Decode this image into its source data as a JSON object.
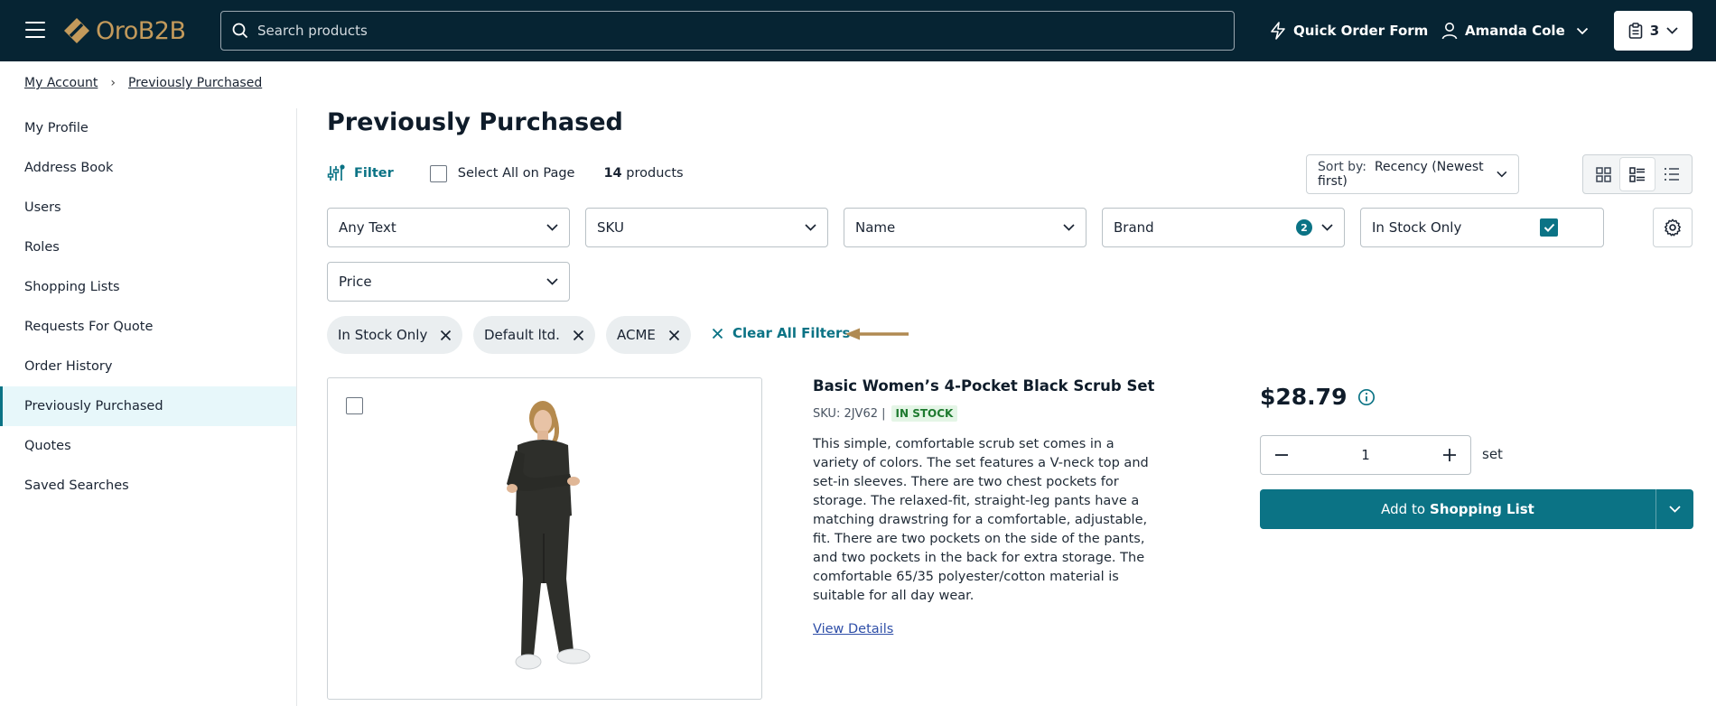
{
  "header": {
    "logo_text": "OroB2B",
    "search_placeholder": "Search products",
    "quick_order_label": "Quick Order Form",
    "user_name": "Amanda Cole",
    "cart_count": "3"
  },
  "breadcrumb": [
    "My Account",
    "Previously Purchased"
  ],
  "sidebar": {
    "items": [
      {
        "label": "My Profile"
      },
      {
        "label": "Address Book"
      },
      {
        "label": "Users"
      },
      {
        "label": "Roles"
      },
      {
        "label": "Shopping Lists"
      },
      {
        "label": "Requests For Quote"
      },
      {
        "label": "Order History"
      },
      {
        "label": "Previously Purchased",
        "active": true
      },
      {
        "label": "Quotes"
      },
      {
        "label": "Saved Searches"
      }
    ]
  },
  "main": {
    "title": "Previously Purchased",
    "filter_label": "Filter",
    "select_all_label": "Select All on Page",
    "count_number": "14",
    "count_suffix": "products",
    "sort_label": "Sort by:",
    "sort_value": "Recency (Newest first)",
    "filters": {
      "any_text": "Any Text",
      "sku": "SKU",
      "name": "Name",
      "brand": "Brand",
      "brand_count": "2",
      "in_stock": "In Stock Only",
      "price": "Price"
    },
    "chips": [
      "In Stock Only",
      "Default ltd.",
      "ACME"
    ],
    "clear_all_label": "Clear All Filters"
  },
  "product": {
    "name": "Basic Women’s 4-Pocket Black Scrub Set",
    "sku": "SKU: 2JV62 |",
    "stock": "IN STOCK",
    "description": "This simple, comfortable scrub set comes in a variety of colors. The set features a V-neck top and set-in sleeves. There are two chest pockets for storage. The relaxed-fit, straight-leg pants have a matching drawstring for a comfortable, adjustable, fit. There are two pockets on the side of the pants, and two pockets in the back for extra storage. The comfortable 65/35 polyester/cotton material is suitable for all day wear.",
    "view_details": "View Details",
    "price": "$28.79",
    "quantity": "1",
    "unit": "set",
    "add_label_prefix": "Add to",
    "add_label_strong": "Shopping List"
  },
  "colors": {
    "header_bg": "#062433",
    "accent": "#0b7385",
    "logo": "#c39a5b",
    "annotation_arrow": "#b08a52"
  }
}
